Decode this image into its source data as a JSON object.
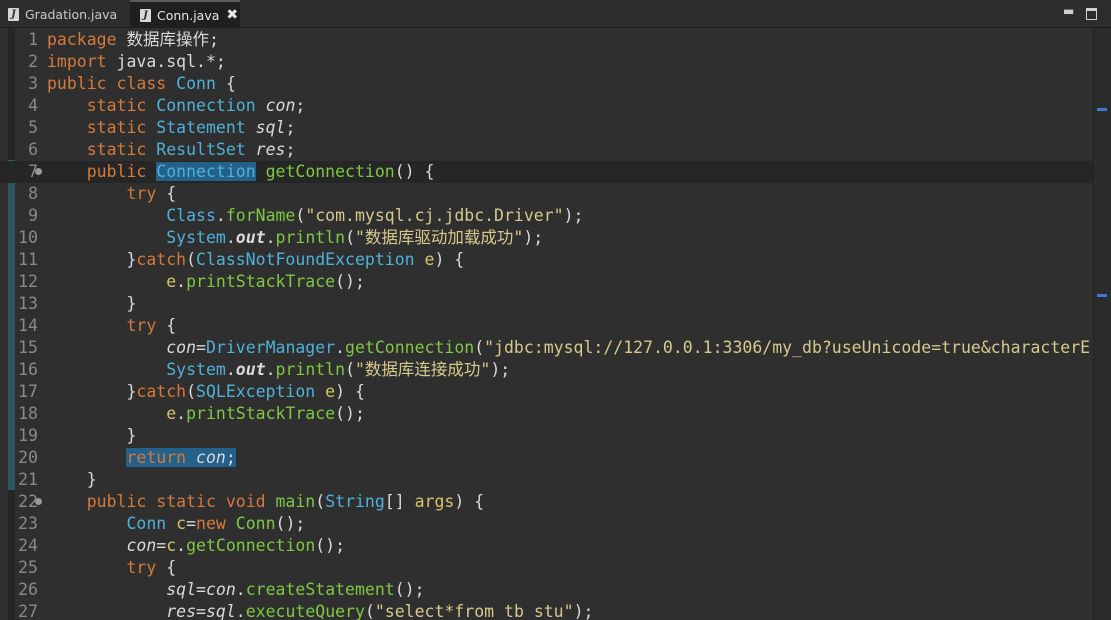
{
  "tabs": [
    {
      "label": "Gradation.java",
      "active": false
    },
    {
      "label": "Conn.java",
      "active": true
    }
  ],
  "tab_close_glyph": "✖",
  "window_controls": {
    "minimize": "▬",
    "maximize": "▣"
  },
  "colors": {
    "keyword": "#d57a3a",
    "type": "#4fb1d9",
    "method": "#7ec842",
    "string": "#d6c98c",
    "selection": "#23608a",
    "background": "#2f2f2f"
  },
  "current_line": 7,
  "code": [
    {
      "n": "1",
      "segs": [
        {
          "c": "kw",
          "t": "package"
        },
        {
          "c": "",
          "t": " 数据库操作;"
        }
      ]
    },
    {
      "n": "2",
      "segs": [
        {
          "c": "kw",
          "t": "import"
        },
        {
          "c": "",
          "t": " java.sql.*;"
        }
      ]
    },
    {
      "n": "3",
      "segs": [
        {
          "c": "kw",
          "t": "public class"
        },
        {
          "c": "",
          "t": " "
        },
        {
          "c": "ty",
          "t": "Conn"
        },
        {
          "c": "",
          "t": " {"
        }
      ]
    },
    {
      "n": "4",
      "segs": [
        {
          "c": "",
          "t": "    "
        },
        {
          "c": "kw",
          "t": "static"
        },
        {
          "c": "",
          "t": " "
        },
        {
          "c": "ty",
          "t": "Connection"
        },
        {
          "c": "",
          "t": " "
        },
        {
          "c": "fd",
          "t": "con"
        },
        {
          "c": "",
          "t": ";"
        }
      ]
    },
    {
      "n": "5",
      "segs": [
        {
          "c": "",
          "t": "    "
        },
        {
          "c": "kw",
          "t": "static"
        },
        {
          "c": "",
          "t": " "
        },
        {
          "c": "ty",
          "t": "Statement"
        },
        {
          "c": "",
          "t": " "
        },
        {
          "c": "fd",
          "t": "sql"
        },
        {
          "c": "",
          "t": ";"
        }
      ]
    },
    {
      "n": "6",
      "segs": [
        {
          "c": "",
          "t": "    "
        },
        {
          "c": "kw",
          "t": "static"
        },
        {
          "c": "",
          "t": " "
        },
        {
          "c": "ty",
          "t": "ResultSet"
        },
        {
          "c": "",
          "t": " "
        },
        {
          "c": "fd",
          "t": "res"
        },
        {
          "c": "",
          "t": ";"
        }
      ]
    },
    {
      "n": "7",
      "fold": true,
      "segs": [
        {
          "c": "",
          "t": "    "
        },
        {
          "c": "kw",
          "t": "public"
        },
        {
          "c": "",
          "t": " "
        },
        {
          "c": "ty hl",
          "t": "Connection"
        },
        {
          "c": "",
          "t": " "
        },
        {
          "c": "mt",
          "t": "getConnection"
        },
        {
          "c": "",
          "t": "() {"
        }
      ]
    },
    {
      "n": "8",
      "segs": [
        {
          "c": "",
          "t": "        "
        },
        {
          "c": "kw",
          "t": "try"
        },
        {
          "c": "",
          "t": " {"
        }
      ]
    },
    {
      "n": "9",
      "segs": [
        {
          "c": "",
          "t": "            "
        },
        {
          "c": "ty",
          "t": "Class"
        },
        {
          "c": "",
          "t": "."
        },
        {
          "c": "mt",
          "t": "forName"
        },
        {
          "c": "",
          "t": "("
        },
        {
          "c": "st",
          "t": "\"com.mysql.cj.jdbc.Driver\""
        },
        {
          "c": "",
          "t": ");"
        }
      ]
    },
    {
      "n": "10",
      "segs": [
        {
          "c": "",
          "t": "            "
        },
        {
          "c": "ty",
          "t": "System"
        },
        {
          "c": "",
          "t": "."
        },
        {
          "c": "so",
          "t": "out"
        },
        {
          "c": "",
          "t": "."
        },
        {
          "c": "mt",
          "t": "println"
        },
        {
          "c": "",
          "t": "("
        },
        {
          "c": "st",
          "t": "\"数据库驱动加载成功\""
        },
        {
          "c": "",
          "t": ");"
        }
      ]
    },
    {
      "n": "11",
      "segs": [
        {
          "c": "",
          "t": "        }"
        },
        {
          "c": "kw",
          "t": "catch"
        },
        {
          "c": "",
          "t": "("
        },
        {
          "c": "ty",
          "t": "ClassNotFoundException"
        },
        {
          "c": "",
          "t": " "
        },
        {
          "c": "vr",
          "t": "e"
        },
        {
          "c": "",
          "t": ") {"
        }
      ]
    },
    {
      "n": "12",
      "segs": [
        {
          "c": "",
          "t": "            "
        },
        {
          "c": "vr",
          "t": "e"
        },
        {
          "c": "",
          "t": "."
        },
        {
          "c": "mt",
          "t": "printStackTrace"
        },
        {
          "c": "",
          "t": "();"
        }
      ]
    },
    {
      "n": "13",
      "segs": [
        {
          "c": "",
          "t": "        }"
        }
      ]
    },
    {
      "n": "14",
      "segs": [
        {
          "c": "",
          "t": "        "
        },
        {
          "c": "kw",
          "t": "try"
        },
        {
          "c": "",
          "t": " {"
        }
      ]
    },
    {
      "n": "15",
      "segs": [
        {
          "c": "",
          "t": "            "
        },
        {
          "c": "fd",
          "t": "con"
        },
        {
          "c": "",
          "t": "="
        },
        {
          "c": "ty",
          "t": "DriverManager"
        },
        {
          "c": "",
          "t": "."
        },
        {
          "c": "mt",
          "t": "getConnection"
        },
        {
          "c": "",
          "t": "("
        },
        {
          "c": "st",
          "t": "\"jdbc:mysql://127.0.0.1:3306/my_db?useUnicode=true&characterE"
        }
      ]
    },
    {
      "n": "16",
      "segs": [
        {
          "c": "",
          "t": "            "
        },
        {
          "c": "ty",
          "t": "System"
        },
        {
          "c": "",
          "t": "."
        },
        {
          "c": "so",
          "t": "out"
        },
        {
          "c": "",
          "t": "."
        },
        {
          "c": "mt",
          "t": "println"
        },
        {
          "c": "",
          "t": "("
        },
        {
          "c": "st",
          "t": "\"数据库连接成功\""
        },
        {
          "c": "",
          "t": ");"
        }
      ]
    },
    {
      "n": "17",
      "segs": [
        {
          "c": "",
          "t": "        }"
        },
        {
          "c": "kw",
          "t": "catch"
        },
        {
          "c": "",
          "t": "("
        },
        {
          "c": "ty",
          "t": "SQLException"
        },
        {
          "c": "",
          "t": " "
        },
        {
          "c": "vr",
          "t": "e"
        },
        {
          "c": "",
          "t": ") {"
        }
      ]
    },
    {
      "n": "18",
      "segs": [
        {
          "c": "",
          "t": "            "
        },
        {
          "c": "vr",
          "t": "e"
        },
        {
          "c": "",
          "t": "."
        },
        {
          "c": "mt",
          "t": "printStackTrace"
        },
        {
          "c": "",
          "t": "();"
        }
      ]
    },
    {
      "n": "19",
      "segs": [
        {
          "c": "",
          "t": "        }"
        }
      ]
    },
    {
      "n": "20",
      "segs": [
        {
          "c": "",
          "t": "        "
        },
        {
          "c": "kw hl",
          "t": "return"
        },
        {
          "c": "hl",
          "t": " "
        },
        {
          "c": "fd hl",
          "t": "con"
        },
        {
          "c": "hl",
          "t": ";"
        }
      ]
    },
    {
      "n": "21",
      "segs": [
        {
          "c": "",
          "t": "    }"
        }
      ]
    },
    {
      "n": "22",
      "fold": true,
      "segs": [
        {
          "c": "",
          "t": "    "
        },
        {
          "c": "kw",
          "t": "public static void"
        },
        {
          "c": "",
          "t": " "
        },
        {
          "c": "mt",
          "t": "main"
        },
        {
          "c": "",
          "t": "("
        },
        {
          "c": "ty",
          "t": "String"
        },
        {
          "c": "",
          "t": "[] "
        },
        {
          "c": "vr",
          "t": "args"
        },
        {
          "c": "",
          "t": ") {"
        }
      ]
    },
    {
      "n": "23",
      "segs": [
        {
          "c": "",
          "t": "        "
        },
        {
          "c": "ty",
          "t": "Conn"
        },
        {
          "c": "",
          "t": " "
        },
        {
          "c": "vr",
          "t": "c"
        },
        {
          "c": "",
          "t": "="
        },
        {
          "c": "kw",
          "t": "new"
        },
        {
          "c": "",
          "t": " "
        },
        {
          "c": "mt",
          "t": "Conn"
        },
        {
          "c": "",
          "t": "();"
        }
      ]
    },
    {
      "n": "24",
      "segs": [
        {
          "c": "",
          "t": "        "
        },
        {
          "c": "fd",
          "t": "con"
        },
        {
          "c": "",
          "t": "="
        },
        {
          "c": "vr",
          "t": "c"
        },
        {
          "c": "",
          "t": "."
        },
        {
          "c": "mt",
          "t": "getConnection"
        },
        {
          "c": "",
          "t": "();"
        }
      ]
    },
    {
      "n": "25",
      "segs": [
        {
          "c": "",
          "t": "        "
        },
        {
          "c": "kw",
          "t": "try"
        },
        {
          "c": "",
          "t": " {"
        }
      ]
    },
    {
      "n": "26",
      "segs": [
        {
          "c": "",
          "t": "            "
        },
        {
          "c": "fd",
          "t": "sql"
        },
        {
          "c": "",
          "t": "="
        },
        {
          "c": "fd",
          "t": "con"
        },
        {
          "c": "",
          "t": "."
        },
        {
          "c": "mt",
          "t": "createStatement"
        },
        {
          "c": "",
          "t": "();"
        }
      ]
    },
    {
      "n": "27",
      "segs": [
        {
          "c": "",
          "t": "            "
        },
        {
          "c": "fd",
          "t": "res"
        },
        {
          "c": "",
          "t": "="
        },
        {
          "c": "fd",
          "t": "sql"
        },
        {
          "c": "",
          "t": "."
        },
        {
          "c": "mt",
          "t": "executeQuery"
        },
        {
          "c": "",
          "t": "("
        },
        {
          "c": "st",
          "t": "\"select*from tb_stu\""
        },
        {
          "c": "",
          "t": ");"
        }
      ]
    }
  ]
}
